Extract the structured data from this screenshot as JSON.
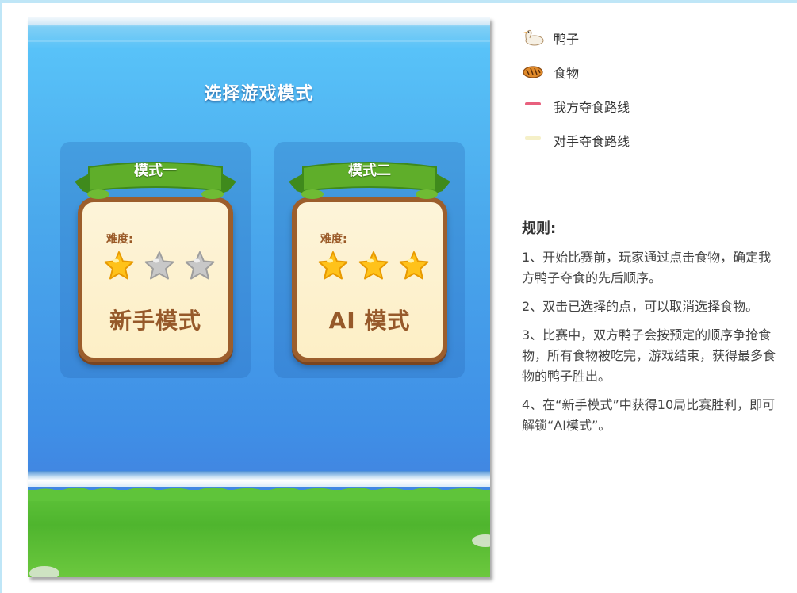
{
  "game": {
    "title": "选择游戏模式",
    "modes": [
      {
        "tag": "模式一",
        "difficulty_label": "难度:",
        "stars_filled": 1,
        "stars_total": 3,
        "name": "新手模式"
      },
      {
        "tag": "模式二",
        "difficulty_label": "难度:",
        "stars_filled": 3,
        "stars_total": 3,
        "name": "AI 模式"
      }
    ]
  },
  "legend": [
    {
      "icon": "duck-icon",
      "label": "鸭子"
    },
    {
      "icon": "bread-icon",
      "label": "食物"
    },
    {
      "icon": "pink-line-icon",
      "label": "我方夺食路线",
      "color": "#e8607e"
    },
    {
      "icon": "yellow-line-icon",
      "label": "对手夺食路线",
      "color": "#f5f0c8"
    }
  ],
  "rules": {
    "title": "规则:",
    "items": [
      "1、开始比赛前，玩家通过点击食物，确定我方鸭子夺食的先后顺序。",
      "2、双击已选择的点，可以取消选择食物。",
      "3、比赛中，双方鸭子会按预定的顺序争抢食物，所有食物被吃完，游戏结束，获得最多食物的鸭子胜出。",
      "4、在“新手模式”中获得10局比赛胜利，即可解锁“AI模式”。"
    ]
  },
  "colors": {
    "water": "#4aa8ec",
    "grass": "#5fc43a",
    "card_border": "#9c5e2c",
    "ribbon": "#5fae2a",
    "star_gold": "#ffc21a",
    "star_gray": "#c4c4c4"
  }
}
